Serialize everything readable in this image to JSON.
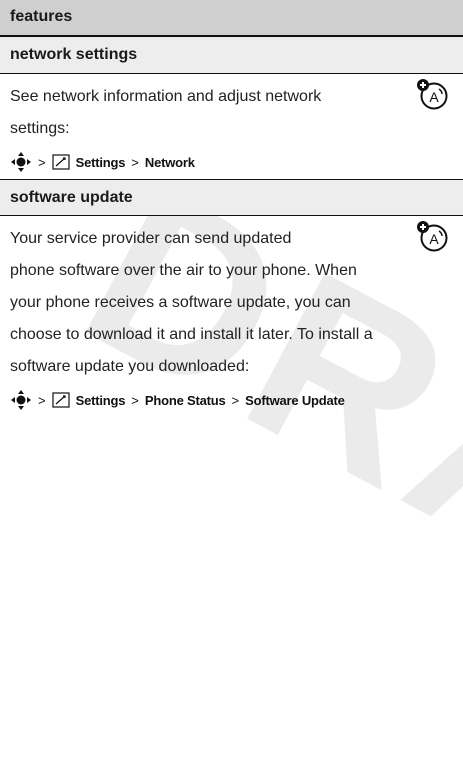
{
  "watermark": "DRAFT",
  "header": {
    "title": "features"
  },
  "sections": [
    {
      "title": "network settings",
      "lines": [
        "See network information and adjust network",
        "settings:"
      ],
      "path": {
        "separator": ">",
        "items": [
          "Settings",
          "Network"
        ]
      },
      "badge_icon": "optional-feature-icon"
    },
    {
      "title": "software update",
      "lines": [
        "Your service provider can send updated",
        "phone software over the air to your phone. When",
        "your phone receives a software update, you can",
        "choose to download it and install it later. To install a",
        "software update you downloaded:"
      ],
      "path": {
        "separator": ">",
        "items": [
          "Settings",
          "Phone Status",
          "Software Update"
        ]
      },
      "badge_icon": "optional-feature-icon"
    }
  ]
}
